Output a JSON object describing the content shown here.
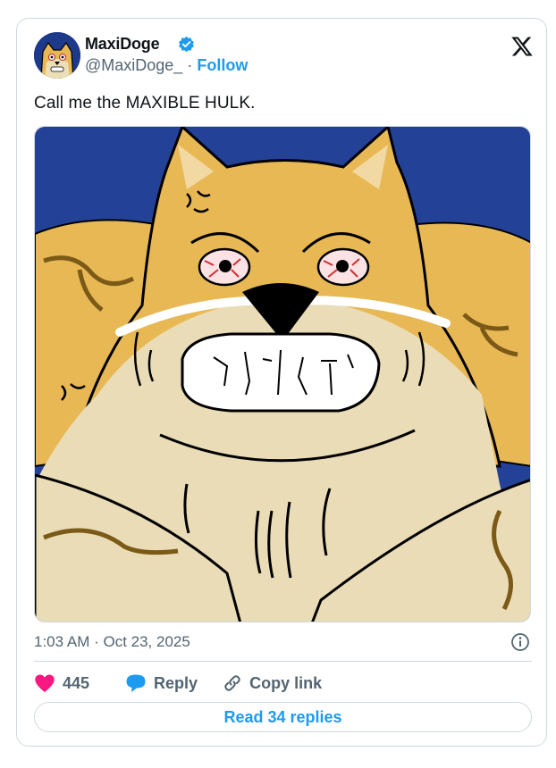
{
  "author": {
    "name": "MaxiDoge",
    "handle": "@MaxiDoge_",
    "separator": "·",
    "follow_label": "Follow",
    "verified": true
  },
  "tweet": {
    "text": "Call me the MAXIBLE HULK.",
    "timestamp": "1:03 AM · Oct 23, 2025"
  },
  "actions": {
    "likes": "445",
    "reply_label": "Reply",
    "copy_link_label": "Copy link",
    "read_replies_label": "Read 34 replies"
  },
  "icons": [
    "x-logo-icon",
    "verified-badge-icon",
    "info-icon",
    "heart-icon",
    "reply-bubble-icon",
    "link-icon"
  ],
  "colors": {
    "accent": "#1d9bf0",
    "heart": "#f91880",
    "muted_text": "#536471",
    "border": "#cfd9de",
    "image_background": "#234197",
    "doge_fur": "#e8b855",
    "doge_cream": "#e9dcb6"
  }
}
